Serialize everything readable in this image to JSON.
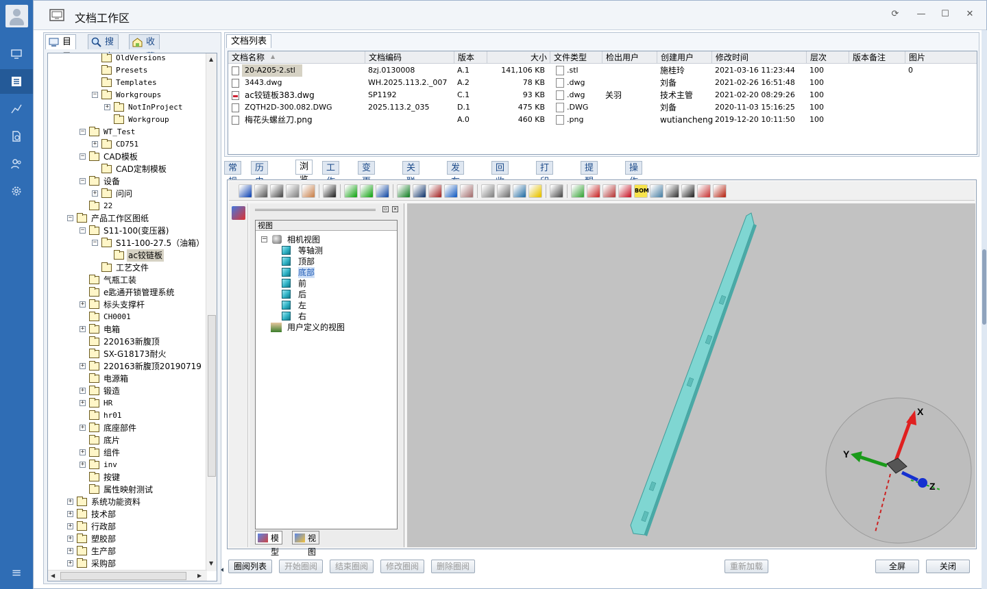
{
  "window": {
    "title": "文档工作区"
  },
  "sidebar": {
    "nav": [
      "monitor-icon",
      "document-list-icon",
      "chart-line-icon",
      "file-sync-icon",
      "users-icon",
      "gear-icon"
    ],
    "collapse": "≡"
  },
  "left_tabs": [
    {
      "label": "目录",
      "icon": "directory-icon"
    },
    {
      "label": "搜索",
      "icon": "search-icon"
    },
    {
      "label": "收藏夹",
      "icon": "favorites-icon"
    }
  ],
  "tree": [
    {
      "label": "OldVersions",
      "mono": true
    },
    {
      "label": "Presets",
      "mono": true
    },
    {
      "label": "Templates",
      "mono": true
    },
    {
      "label": "Workgroups",
      "mono": true
    },
    {
      "label": "NotInProject",
      "mono": true
    },
    {
      "label": "Workgroup",
      "mono": true
    },
    {
      "label": "WT_Test",
      "mono": true
    },
    {
      "label": "CD751",
      "mono": true
    },
    {
      "label": "CAD模板"
    },
    {
      "label": "CAD定制模板"
    },
    {
      "label": "设备"
    },
    {
      "label": "问问"
    },
    {
      "label": "22",
      "mono": true
    },
    {
      "label": "产品工作区图纸"
    },
    {
      "label": "S11-100(变压器)"
    },
    {
      "label": "S11-100-27.5（油箱）"
    },
    {
      "label": "ac铰链板"
    },
    {
      "label": "工艺文件"
    },
    {
      "label": "气瓶工装"
    },
    {
      "label": "e匙通开锁管理系统"
    },
    {
      "label": "标头支撑杆"
    },
    {
      "label": "CH0001",
      "mono": true
    },
    {
      "label": "电箱"
    },
    {
      "label": "220163新腹顶"
    },
    {
      "label": "SX-G18173耐火"
    },
    {
      "label": "220163新腹顶20190719"
    },
    {
      "label": "电源箱"
    },
    {
      "label": "锻造"
    },
    {
      "label": "HR",
      "mono": true
    },
    {
      "label": "hr01",
      "mono": true
    },
    {
      "label": "底座部件"
    },
    {
      "label": "底片"
    },
    {
      "label": "组件"
    },
    {
      "label": "inv",
      "mono": true
    },
    {
      "label": "按键"
    },
    {
      "label": "属性映射测试"
    },
    {
      "label": "系统功能资料"
    },
    {
      "label": "技术部"
    },
    {
      "label": "行政部"
    },
    {
      "label": "塑胶部"
    },
    {
      "label": "生产部"
    },
    {
      "label": "采购部"
    }
  ],
  "doclist": {
    "tab": "文档列表",
    "columns": [
      "文档名称",
      "文档编码",
      "版本",
      "大小",
      "文件类型",
      "检出用户",
      "创建用户",
      "修改时间",
      "层次",
      "版本备注",
      "图片"
    ],
    "rows": [
      {
        "name": "20-A205-2.stl",
        "code": "8zj.0130008",
        "ver": "A.1",
        "size": "141,106 KB",
        "type": ".stl",
        "checkout": "",
        "creator": "施桂玲",
        "modified": "2021-03-16 11:23:44",
        "level": "100",
        "note": "",
        "pic": "0"
      },
      {
        "name": "3443.dwg",
        "code": "WH.2025.113.2._007",
        "ver": "A.2",
        "size": "78 KB",
        "type": ".dwg",
        "checkout": "",
        "creator": "刘备",
        "modified": "2021-02-26 16:51:48",
        "level": "100",
        "note": "",
        "pic": ""
      },
      {
        "name": "ac铰链板383.dwg",
        "code": "SP1192",
        "ver": "C.1",
        "size": "93 KB",
        "type": ".dwg",
        "checkout": "关羽",
        "creator": "技术主管",
        "modified": "2021-02-20 08:29:26",
        "level": "100",
        "note": "",
        "pic": ""
      },
      {
        "name": "ZQTH2D-300.082.DWG",
        "code": "2025.113.2_035",
        "ver": "D.1",
        "size": "475 KB",
        "type": ".DWG",
        "checkout": "",
        "creator": "刘备",
        "modified": "2020-11-03 15:16:25",
        "level": "100",
        "note": "",
        "pic": ""
      },
      {
        "name": "梅花头螺丝刀.png",
        "code": "",
        "ver": "A.0",
        "size": "460 KB",
        "type": ".png",
        "checkout": "",
        "creator": "wutiancheng",
        "modified": "2019-12-20 10:11:50",
        "level": "100",
        "note": "",
        "pic": ""
      }
    ]
  },
  "detail_tabs": [
    "常规",
    "历史版本",
    "浏览",
    "工作流",
    "变更记录",
    "关联文档",
    "发布记录",
    "回收记录",
    "打印记录",
    "提醒设置",
    "操作日志"
  ],
  "viewer": {
    "tree_header": "视图",
    "root": "相机视图",
    "views": [
      "等轴测",
      "顶部",
      "底部",
      "前",
      "后",
      "左",
      "右"
    ],
    "custom": "用户定义的视图",
    "bottom_tabs": [
      "模型",
      "视图"
    ],
    "axes": {
      "x": "X",
      "y": "Y",
      "z": "Z"
    },
    "toolbar_first_label": "BOM",
    "colors": {
      "model": "#7fd6d2",
      "background": "#c2c2c2",
      "x_axis": "#e02020",
      "y_axis": "#1a9a1a",
      "z_axis": "#1530d0"
    }
  },
  "footer": {
    "left_buttons": [
      "圈阅列表",
      "开始圈阅",
      "结束圈阅",
      "修改圈阅",
      "删除圈阅"
    ],
    "reload": "重新加载",
    "fullscreen": "全屏",
    "close": "关闭"
  },
  "window_controls": {
    "refresh": "⟳",
    "minimize": "—",
    "maximize": "☐",
    "close": "✕"
  }
}
